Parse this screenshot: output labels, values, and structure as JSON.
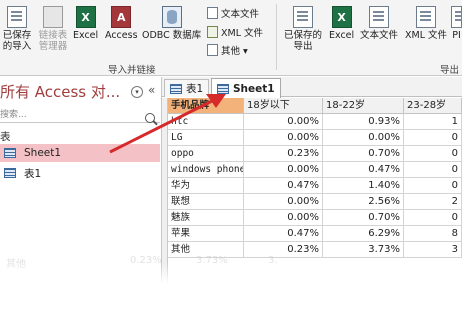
{
  "ribbon": {
    "import_group_label": "导入并链接",
    "export_group_label": "导出",
    "import": {
      "saved_imports_label": "已保存的导入",
      "linked_table_manager_label": "链接表管理器",
      "excel_label": "Excel",
      "access_label": "Access",
      "odbc_label": "ODBC 数据库",
      "text_file_label": "文本文件",
      "xml_file_label": "XML 文件",
      "more_label": "其他 ▾"
    },
    "export": {
      "saved_exports_label": "已保存的导出",
      "excel_label": "Excel",
      "text_file_label": "文本文件",
      "xml_file_label": "XML 文件",
      "pdf_label": "PI"
    }
  },
  "nav": {
    "title": "所有 Access 对...",
    "search_placeholder": "搜索...",
    "group_label": "表",
    "items": [
      {
        "label": "Sheet1",
        "selected": true
      },
      {
        "label": "表1",
        "selected": false
      }
    ]
  },
  "doc": {
    "tabs": [
      {
        "label": "表1",
        "active": false
      },
      {
        "label": "Sheet1",
        "active": true
      }
    ],
    "columns": [
      "手机品牌",
      "18岁以下",
      "18-22岁",
      "23-28岁"
    ],
    "rows": [
      [
        "htc",
        "0.00%",
        "0.93%",
        "1"
      ],
      [
        "LG",
        "0.00%",
        "0.00%",
        "0"
      ],
      [
        "oppo",
        "0.23%",
        "0.70%",
        "0"
      ],
      [
        "windows phone",
        "0.00%",
        "0.47%",
        "0"
      ],
      [
        "华为",
        "0.47%",
        "1.40%",
        "0"
      ],
      [
        "联想",
        "0.00%",
        "2.56%",
        "2"
      ],
      [
        "魅族",
        "0.00%",
        "0.70%",
        "0"
      ],
      [
        "苹果",
        "0.47%",
        "6.29%",
        "8"
      ],
      [
        "其他",
        "0.23%",
        "3.73%",
        "3"
      ]
    ],
    "ghost_row": [
      "其他",
      "0.23%",
      "3.73%",
      "3."
    ]
  },
  "colors": {
    "nav_title": "#a03e3e",
    "selected_item": "#f4c2c6",
    "selected_header": "#f2b27a",
    "arrow": "#d62a2a",
    "excel_icon": "#1e7145",
    "access_icon": "#a4373a"
  }
}
